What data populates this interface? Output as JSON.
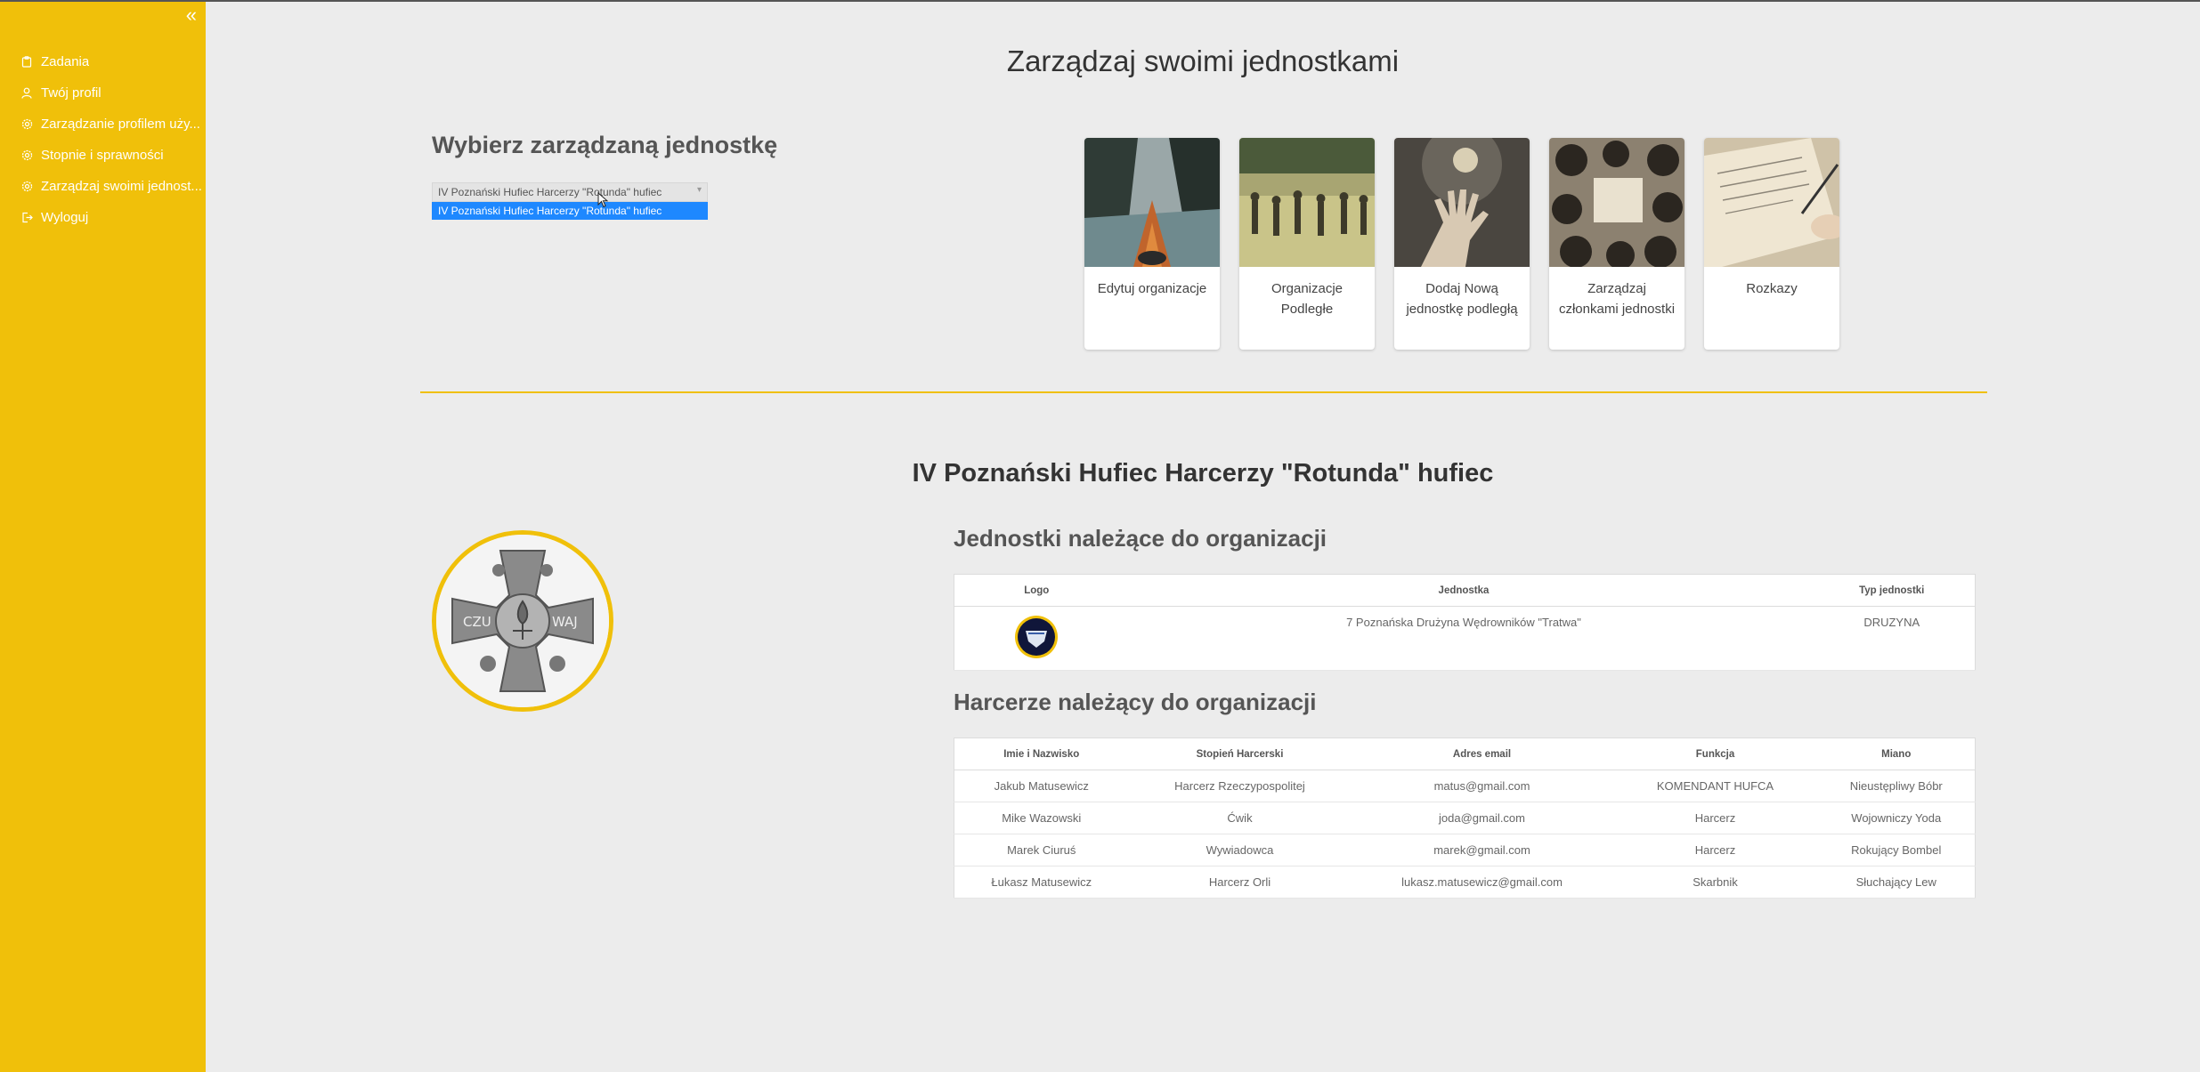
{
  "sidebar": {
    "collapse_glyph": "«",
    "items": [
      {
        "icon": "clipboard-icon",
        "label": "Zadania"
      },
      {
        "icon": "user-icon",
        "label": "Twój profil"
      },
      {
        "icon": "gear-icon",
        "label": "Zarządzanie profilem uży..."
      },
      {
        "icon": "gear-icon",
        "label": "Stopnie i sprawności"
      },
      {
        "icon": "gear-icon",
        "label": "Zarządzaj swoimi jednost..."
      },
      {
        "icon": "logout-icon",
        "label": "Wyloguj"
      }
    ]
  },
  "page": {
    "title": "Zarządzaj swoimi jednostkami",
    "select_title": "Wybierz zarządzaną jednostkę",
    "select_value": "IV Poznański Hufiec Harcerzy \"Rotunda\" hufiec",
    "select_option": "IV Poznański Hufiec Harcerzy \"Rotunda\" hufiec"
  },
  "cards": [
    {
      "label": "Edytuj organizacje",
      "image": "kayak-image"
    },
    {
      "label": "Organizacje Podległe",
      "image": "soldiers-field-image"
    },
    {
      "label": "Dodaj Nową jednostkę podległą",
      "image": "open-hand-image"
    },
    {
      "label": "Zarządzaj członkami jednostki",
      "image": "group-huddle-image"
    },
    {
      "label": "Rozkazy",
      "image": "writing-notebook-image"
    }
  ],
  "org": {
    "title": "IV Poznański Hufiec Harcerzy \"Rotunda\" hufiec",
    "emblem_text_left": "CZU",
    "emblem_text_right": "WAJ"
  },
  "units": {
    "title": "Jednostki należące do organizacji",
    "headers": [
      "Logo",
      "Jednostka",
      "Typ jednostki"
    ],
    "rows": [
      {
        "logo": "unit-logo",
        "name": "7 Poznańska Drużyna Wędrowników \"Tratwa\"",
        "type": "DRUZYNA"
      }
    ]
  },
  "members": {
    "title": "Harcerze należący do organizacji",
    "headers": [
      "Imie i Nazwisko",
      "Stopień Harcerski",
      "Adres email",
      "Funkcja",
      "Miano"
    ],
    "rows": [
      [
        "Jakub Matusewicz",
        "Harcerz Rzeczypospolitej",
        "matus@gmail.com",
        "KOMENDANT HUFCA",
        "Nieustępliwy Bóbr"
      ],
      [
        "Mike Wazowski",
        "Ćwik",
        "joda@gmail.com",
        "Harcerz",
        "Wojowniczy Yoda"
      ],
      [
        "Marek Ciuruś",
        "Wywiadowca",
        "marek@gmail.com",
        "Harcerz",
        "Rokujący Bombel"
      ],
      [
        "Łukasz Matusewicz",
        "Harcerz Orli",
        "lukasz.matusewicz@gmail.com",
        "Skarbnik",
        "Słuchający Lew"
      ]
    ]
  },
  "colors": {
    "sidebar": "#f0c00a",
    "selected_option": "#1e88ff",
    "background": "#ececec"
  }
}
